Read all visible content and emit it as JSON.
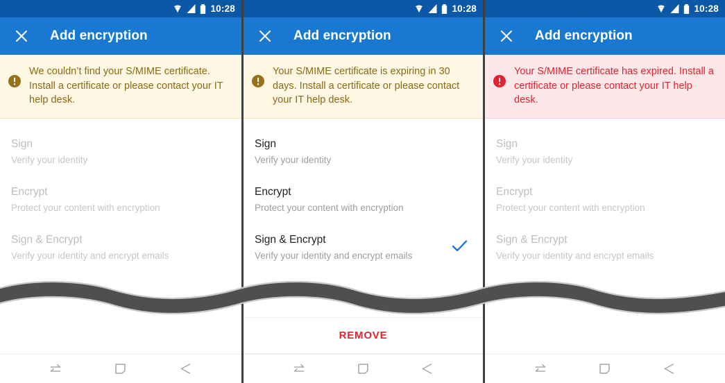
{
  "colors": {
    "status_bar": "#0b59a6",
    "app_bar": "#1878d2",
    "warning_bg": "#fdf7e3",
    "warning_text": "#8a6b12",
    "danger_bg": "#fce8e9",
    "danger_text": "#e0232e",
    "accent_check": "#1a73d4",
    "remove_text": "#e0232e",
    "divider_band": "#4f4f4f"
  },
  "status_bar": {
    "time": "10:28",
    "icons": [
      "wifi-icon",
      "cellular-signal-icon",
      "battery-icon"
    ]
  },
  "app_bar": {
    "close_icon": "close-icon",
    "title": "Add encryption"
  },
  "options_common": [
    {
      "title": "Sign",
      "subtitle": "Verify your identity"
    },
    {
      "title": "Encrypt",
      "subtitle": "Protect your content with encryption"
    },
    {
      "title": "Sign & Encrypt",
      "subtitle": "Verify your identity and encrypt emails"
    }
  ],
  "nav_bar": {
    "buttons": [
      {
        "name": "recents-button",
        "icon": "recent-apps-icon"
      },
      {
        "name": "home-button",
        "icon": "home-square-icon"
      },
      {
        "name": "back-button",
        "icon": "back-arrow-icon"
      }
    ]
  },
  "panels": [
    {
      "id": "panel-missing-certificate",
      "banner": {
        "severity": "warning",
        "icon": "warning-exclamation-icon",
        "text": "We couldn’t find your S/MIME certificate. Install a certificate or please contact your IT help desk."
      },
      "options_enabled": false,
      "selected_index": -1,
      "remove_button": null
    },
    {
      "id": "panel-expiring-certificate",
      "banner": {
        "severity": "warning",
        "icon": "warning-exclamation-icon",
        "text": "Your S/MIME certificate is expiring in 30 days. Install a certificate or please contact your IT help desk."
      },
      "options_enabled": true,
      "selected_index": 2,
      "remove_button": {
        "label": "REMOVE"
      }
    },
    {
      "id": "panel-expired-certificate",
      "banner": {
        "severity": "danger",
        "icon": "error-exclamation-icon",
        "text": "Your S/MIME certificate has expired. Install a certificate or please contact your IT help desk."
      },
      "options_enabled": false,
      "selected_index": -1,
      "remove_button": null
    }
  ]
}
